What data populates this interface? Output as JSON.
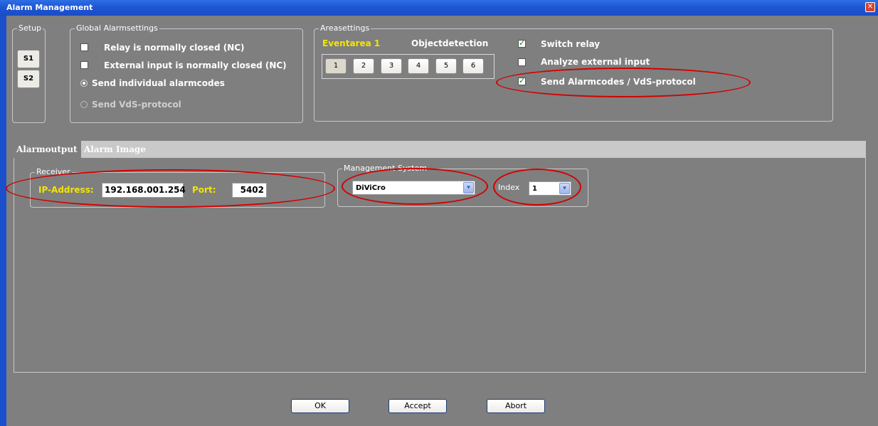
{
  "window": {
    "title": "Alarm Management",
    "close_glyph": "✕"
  },
  "setup": {
    "legend": "Setup",
    "s1": "S1",
    "s2": "S2"
  },
  "global": {
    "legend": "Global Alarmsettings",
    "relay_nc": "Relay is normally closed (NC)",
    "ext_nc": "External input is normally closed (NC)",
    "send_individual": "Send individual alarmcodes",
    "send_vds": "Send VdS-protocol"
  },
  "area": {
    "legend": "Areasettings",
    "eventarea": "Eventarea 1",
    "objectdetection": "Objectdetection",
    "buttons": [
      "1",
      "2",
      "3",
      "4",
      "5",
      "6"
    ],
    "switch_relay": "Switch relay",
    "analyze_external": "Analyze external input",
    "send_alarmcodes": "Send Alarmcodes / VdS-protocol"
  },
  "tabs": {
    "alarmoutput": "Alarmoutput",
    "alarm_image": "Alarm Image"
  },
  "receiver": {
    "legend": "Receiver",
    "ip_label": "IP-Address:",
    "ip_value": "192.168.001.254",
    "port_label": "Port:",
    "port_value": "5402"
  },
  "management": {
    "legend": "Management System",
    "system_value": "DiViCro",
    "index_label": "Index",
    "index_value": "1"
  },
  "footer": {
    "ok": "OK",
    "accept": "Accept",
    "abort": "Abort"
  },
  "colors": {
    "accent_yellow": "#f5e500",
    "highlight_red": "#d40000",
    "titlebar_blue": "#1f56d4"
  }
}
